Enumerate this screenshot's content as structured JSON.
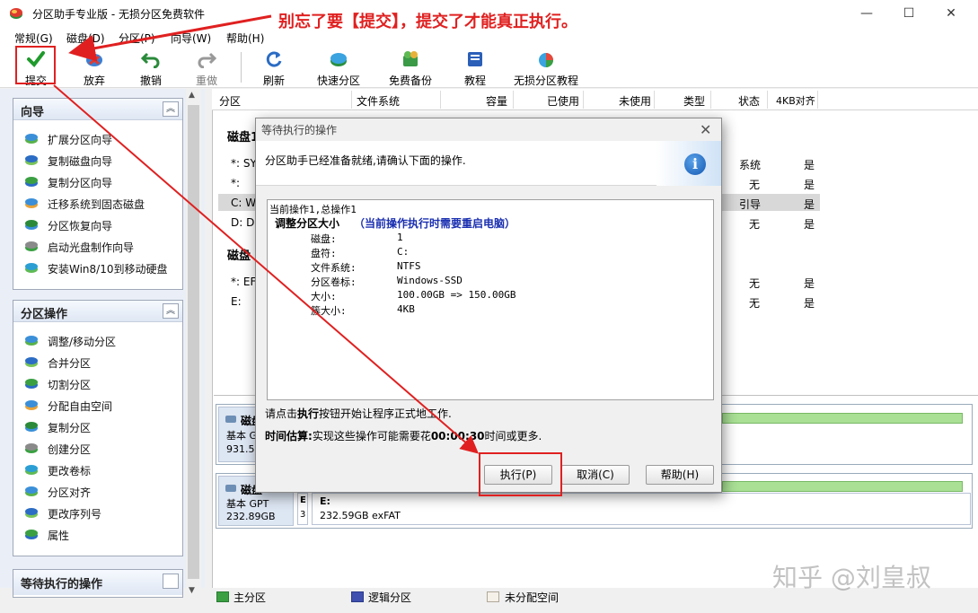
{
  "window": {
    "title": "分区助手专业版 - 无损分区免费软件",
    "minimize": "—",
    "maximize": "☐",
    "close": "✕"
  },
  "menu": [
    "常规(G)",
    "磁盘(D)",
    "分区(P)",
    "向导(W)",
    "帮助(H)"
  ],
  "toolbar": {
    "submit": "提交",
    "discard": "放弃",
    "undo": "撤销",
    "redo": "重做",
    "refresh": "刷新",
    "quick_partition": "快速分区",
    "free_backup": "免费备份",
    "tutorial": "教程",
    "lossless_tutorial": "无损分区教程"
  },
  "wizard_panel": {
    "title": "向导",
    "items": [
      "扩展分区向导",
      "复制磁盘向导",
      "复制分区向导",
      "迁移系统到固态磁盘",
      "分区恢复向导",
      "启动光盘制作向导",
      "安装Win8/10到移动硬盘"
    ]
  },
  "partition_panel": {
    "title": "分区操作",
    "items": [
      "调整/移动分区",
      "合并分区",
      "切割分区",
      "分配自由空间",
      "复制分区",
      "创建分区",
      "更改卷标",
      "分区对齐",
      "更改序列号",
      "属性"
    ]
  },
  "pending_panel": {
    "title": "等待执行的操作"
  },
  "columns": [
    "分区",
    "文件系统",
    "容量",
    "已使用",
    "未使用",
    "类型",
    "状态",
    "4KB对齐"
  ],
  "disk1": {
    "label": "磁盘1",
    "rows": [
      {
        "name": "*: SYS",
        "status": "系统",
        "aligned": "是"
      },
      {
        "name": "*:",
        "status": "无",
        "aligned": "是"
      },
      {
        "name": "C: Wi",
        "status": "引导",
        "aligned": "是"
      },
      {
        "name": "D: Da",
        "status": "无",
        "aligned": "是"
      }
    ]
  },
  "disk2": {
    "label": "磁盘",
    "rows": [
      {
        "name": "*: EFI",
        "status": "无",
        "aligned": "是"
      },
      {
        "name": "E:",
        "status": "无",
        "aligned": "是"
      }
    ]
  },
  "diskmap1": {
    "name": "磁盘",
    "type": "基本 G",
    "size": "931.5"
  },
  "diskmap2": {
    "name": "磁盘",
    "type": "基本 GPT",
    "size": "232.89GB",
    "small1": "E",
    "small2": "3",
    "part_label": "E:",
    "part_info": "232.59GB exFAT"
  },
  "legend": {
    "primary": "主分区",
    "logical": "逻辑分区",
    "unallocated": "未分配空间",
    "colors": {
      "primary": "#2f9e44",
      "logical": "#4050b0",
      "unallocated": "#f5f0e8"
    }
  },
  "dialog": {
    "title": "等待执行的操作",
    "close": "✕",
    "message": "分区助手已经准备就绪,请确认下面的操作.",
    "info_icon": "i",
    "ops": {
      "header": "当前操作1,总操作1",
      "op_title": "调整分区大小",
      "op_note": "（当前操作执行时需要重启电脑）",
      "fields": [
        {
          "k": "磁盘:",
          "v": "1"
        },
        {
          "k": "盘符:",
          "v": "C:"
        },
        {
          "k": "文件系统:",
          "v": "NTFS"
        },
        {
          "k": "分区卷标:",
          "v": "Windows-SSD"
        },
        {
          "k": "大小:",
          "v": "100.00GB => 150.00GB"
        },
        {
          "k": "簇大小:",
          "v": "4KB"
        }
      ]
    },
    "hint_pre": "请点击",
    "hint_bold": "执行",
    "hint_post": "按钮开始让程序正式地工作.",
    "estimate_label": "时间估算:",
    "estimate_pre": "实现这些操作可能需要花",
    "estimate_time": "00:00:30",
    "estimate_post": "时间或更多.",
    "btn_execute": "执行(P)",
    "btn_cancel": "取消(C)",
    "btn_help": "帮助(H)"
  },
  "annotation": "别忘了要【提交】，提交了才能真正执行。",
  "watermark": "知乎 @刘皇叔",
  "annotation_color": "#e02020"
}
